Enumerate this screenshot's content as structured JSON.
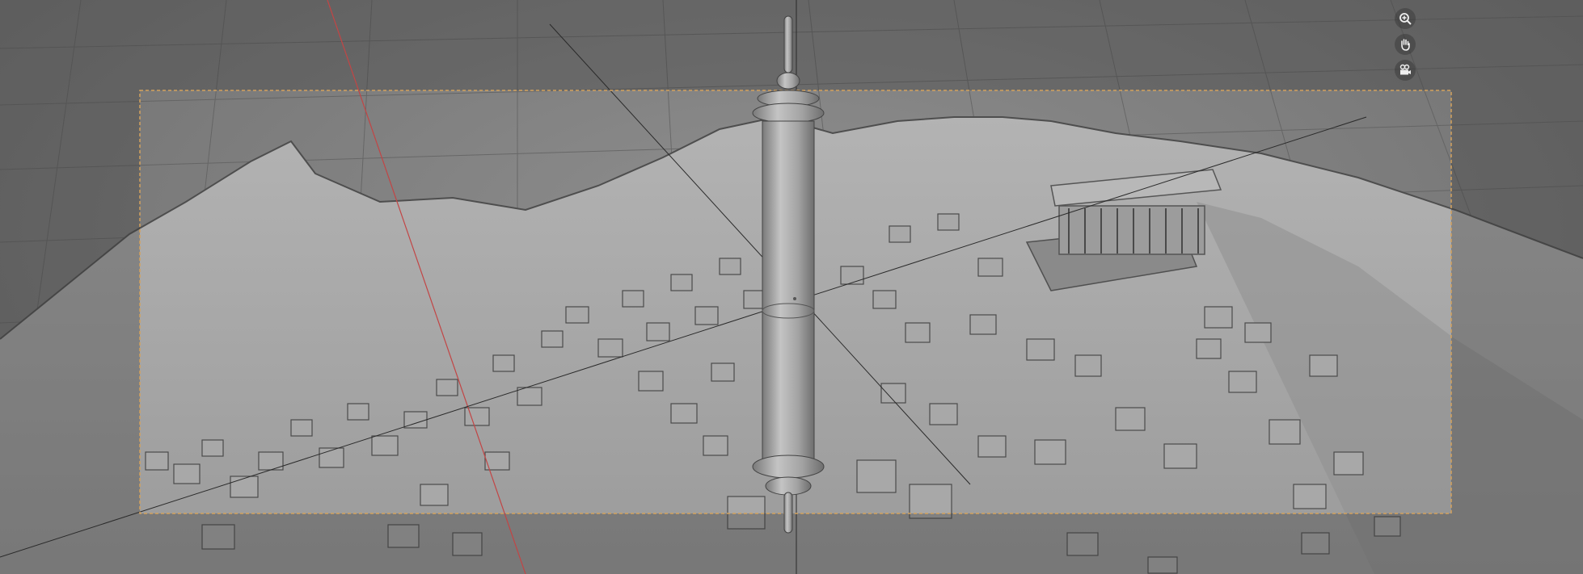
{
  "viewport": {
    "mode": "camera-view",
    "colors": {
      "background": "#7c7c7c",
      "grid": "#5e5e5e",
      "x_axis": "#c24545",
      "camera_frame": "#d3a25e",
      "outside_shade": "#3a3a3a",
      "terrain": "#a6a6a6",
      "column": "#9a9a9a"
    }
  },
  "navigation_gizmo": {
    "tools": [
      {
        "name": "zoom",
        "icon": "zoom-in-icon"
      },
      {
        "name": "pan",
        "icon": "hand-icon"
      },
      {
        "name": "camera",
        "icon": "camera-icon"
      }
    ]
  }
}
